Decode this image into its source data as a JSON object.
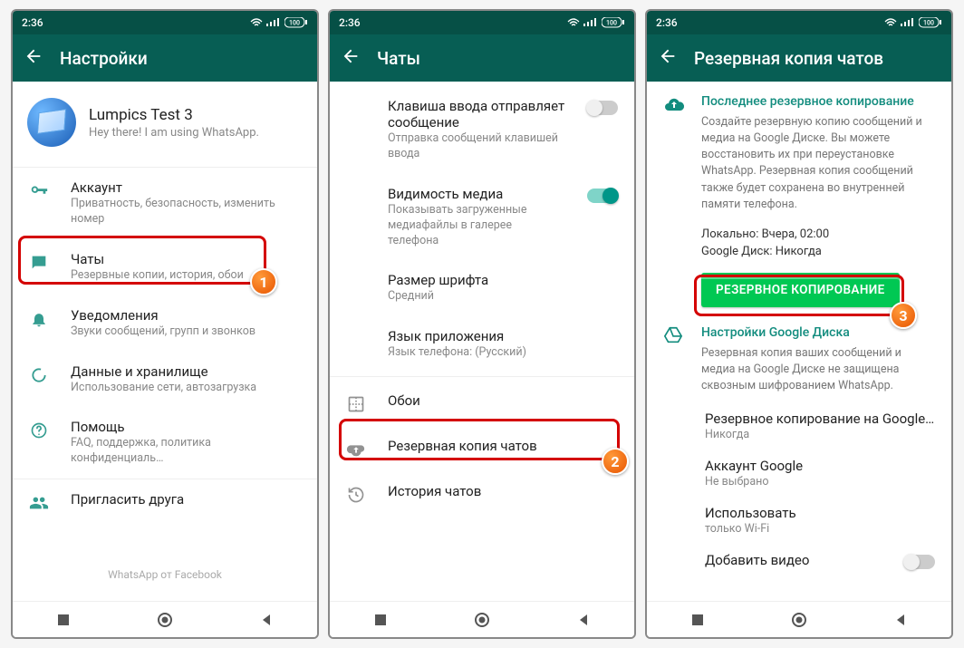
{
  "status": {
    "time": "2:36",
    "battery": "100"
  },
  "screen1": {
    "title": "Настройки",
    "profile": {
      "name": "Lumpics Test 3",
      "status": "Hey there! I am using WhatsApp."
    },
    "items": [
      {
        "title": "Аккаунт",
        "sub": "Приватность, безопасность, изменить номер"
      },
      {
        "title": "Чаты",
        "sub": "Резервные копии, история, обои"
      },
      {
        "title": "Уведомления",
        "sub": "Звуки сообщений, групп и звонков"
      },
      {
        "title": "Данные и хранилище",
        "sub": "Использование сети, автозагрузка"
      },
      {
        "title": "Помощь",
        "sub": "FAQ, поддержка, политика конфиденциаль…"
      },
      {
        "title": "Пригласить друга",
        "sub": ""
      }
    ],
    "footer": "WhatsApp от Facebook"
  },
  "screen2": {
    "title": "Чаты",
    "enterSend": {
      "title": "Клавиша ввода отправляет сообщение",
      "sub": "Отправка сообщений клавишей ввода"
    },
    "mediaVis": {
      "title": "Видимость медиа",
      "sub": "Показывать загруженные медиафайлы в галерее телефона"
    },
    "fontSize": {
      "title": "Размер шрифта",
      "sub": "Средний"
    },
    "appLang": {
      "title": "Язык приложения",
      "sub": "Язык телефона: (Русский)"
    },
    "wallpaper": "Обои",
    "backup": "Резервная копия чатов",
    "history": "История чатов"
  },
  "screen3": {
    "title": "Резервная копия чатов",
    "lastBackupTitle": "Последнее резервное копирование",
    "lastBackupDesc": "Создайте резервную копию сообщений и медиа на Google Диске. Вы можете восстановить их при переустановке WhatsApp. Резервная копия сообщений также будет сохранена во внутренней памяти телефона.",
    "localLine": "Локально: Вчера, 02:00",
    "gdriveLine": "Google Диск: Никогда",
    "button": "РЕЗЕРВНОЕ КОПИРОВАНИЕ",
    "gdTitle": "Настройки Google Диска",
    "gdDesc": "Резервная копия ваших сообщений и медиа на Google Диске не защищена сквозным шифрованием WhatsApp.",
    "opts": [
      {
        "title": "Резервное копирование на Google…",
        "sub": "Никогда"
      },
      {
        "title": "Аккаунт Google",
        "sub": "Не выбрано"
      },
      {
        "title": "Использовать",
        "sub": "только Wi-Fi"
      },
      {
        "title": "Добавить видео",
        "sub": ""
      }
    ]
  },
  "badges": {
    "b1": "1",
    "b2": "2",
    "b3": "3"
  }
}
